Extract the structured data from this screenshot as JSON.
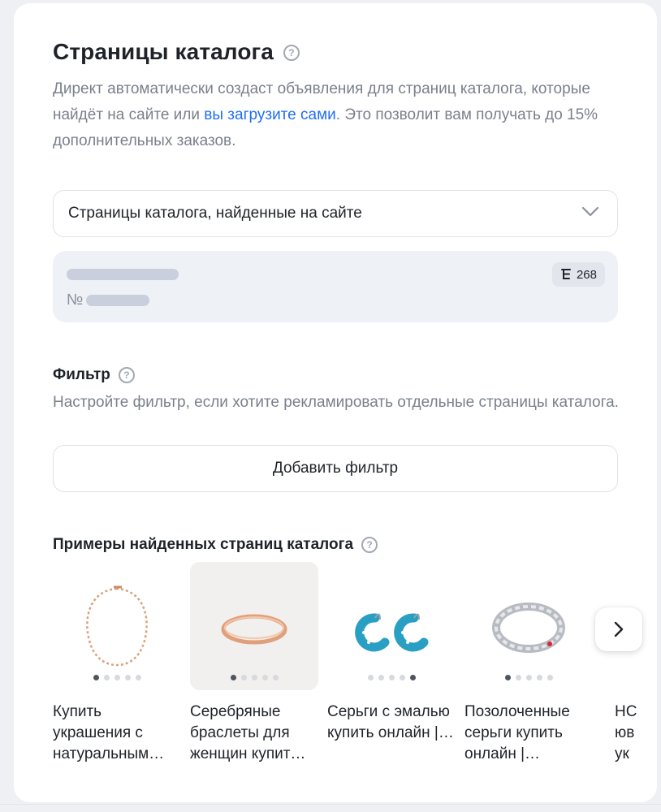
{
  "header": {
    "title": "Страницы каталога",
    "description_before": "Директ автоматически создаст объявления для страниц каталога, которые найдёт на сайте или ",
    "description_link": "вы загрузите сами",
    "description_after": ". Это позволит вам получать до 15% дополнительных заказов."
  },
  "source_select": {
    "value": "Страницы каталога, найденные на сайте"
  },
  "site": {
    "number_prefix": "№",
    "count": "268"
  },
  "filter": {
    "title": "Фильтр",
    "description": "Настройте фильтр, если хотите рекламировать отдельные страницы каталога.",
    "add_label": "Добавить фильтр"
  },
  "examples": {
    "title": "Примеры найденных страниц каталога",
    "items": [
      {
        "caption": "Купить украшения с натуральным…",
        "image": "necklace",
        "active_dot": 1,
        "dots": 5
      },
      {
        "caption": "Серебряные браслеты для женщин купит…",
        "image": "bracelet",
        "active_dot": 1,
        "dots": 5
      },
      {
        "caption": "Серьги с эмалью купить онлайн |…",
        "image": "earrings",
        "active_dot": 5,
        "dots": 5
      },
      {
        "caption": "Позолоченные серьги купить онлайн |…",
        "image": "ring",
        "active_dot": 1,
        "dots": 5
      },
      {
        "caption": "НС юв ук",
        "image": "partial",
        "active_dot": 1,
        "dots": 5
      }
    ]
  },
  "icons": {
    "help": "question-circle-icon",
    "dropdown": "chevron-down-icon",
    "tree": "tree-structure-icon",
    "next": "chevron-right-icon"
  },
  "colors": {
    "link": "#1f6ff2",
    "muted_text": "#7a808c",
    "panel_bg": "#eef1f5"
  }
}
